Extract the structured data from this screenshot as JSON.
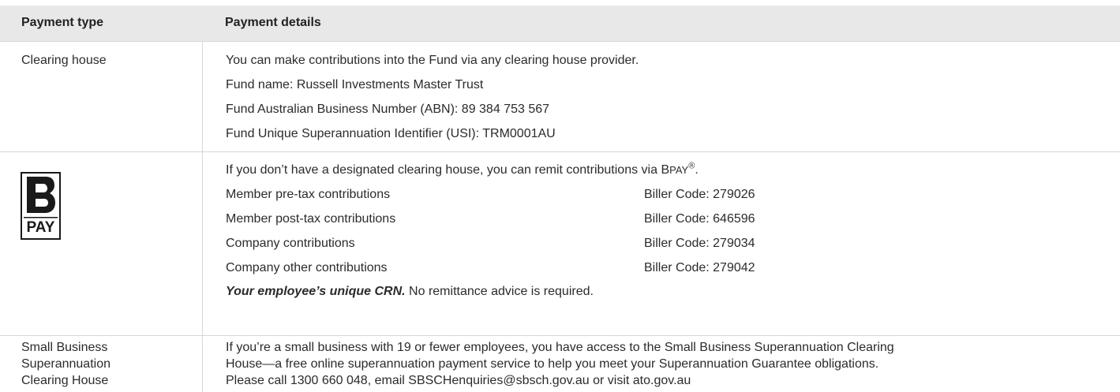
{
  "header": {
    "col1": "Payment type",
    "col2": "Payment details"
  },
  "clearing_house": {
    "type": "Clearing house",
    "lines": [
      "You can make contributions into the Fund via any clearing house provider.",
      "Fund name: Russell Investments Master Trust",
      "Fund Australian Business Number (ABN): 89 384 753 567",
      "Fund Unique Superannuation Identifier (USI): TRM0001AU"
    ]
  },
  "bpay": {
    "logo_label": "PAY",
    "intro_prefix": "If you don’t have a designated clearing house, you can remit contributions via B",
    "intro_brand_rest": "PAY",
    "intro_reg": "®",
    "intro_suffix": ".",
    "codes": [
      {
        "label": "Member pre-tax contributions",
        "code": "Biller Code: 279026"
      },
      {
        "label": "Member post-tax contributions",
        "code": "Biller Code: 646596"
      },
      {
        "label": "Company contributions",
        "code": "Biller Code: 279034"
      },
      {
        "label": "Company other contributions",
        "code": "Biller Code: 279042"
      }
    ],
    "crn_bold": "Your employee’s unique CRN.",
    "crn_rest": " No remittance advice is required."
  },
  "sbsch": {
    "type_lines": [
      "Small Business",
      "Superannuation",
      "Clearing House"
    ],
    "lines": [
      "If you’re a small business with 19 or fewer employees, you have access to the Small Business Superannuation Clearing",
      "House—a free online superannuation payment service to help you meet your Superannuation Guarantee obligations.",
      "Please call 1300 660 048, email SBSCHenquiries@sbsch.gov.au or visit ato.gov.au"
    ]
  }
}
